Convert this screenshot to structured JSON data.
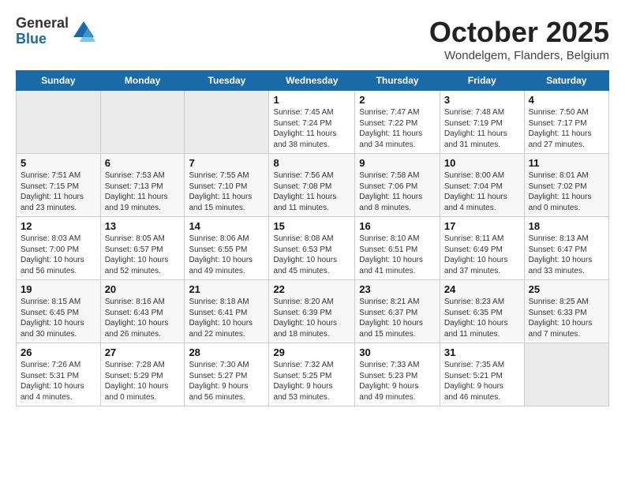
{
  "header": {
    "logo": {
      "general": "General",
      "blue": "Blue"
    },
    "title": "October 2025",
    "location": "Wondelgem, Flanders, Belgium"
  },
  "weekdays": [
    "Sunday",
    "Monday",
    "Tuesday",
    "Wednesday",
    "Thursday",
    "Friday",
    "Saturday"
  ],
  "weeks": [
    [
      {
        "num": "",
        "info": ""
      },
      {
        "num": "",
        "info": ""
      },
      {
        "num": "",
        "info": ""
      },
      {
        "num": "1",
        "info": "Sunrise: 7:45 AM\nSunset: 7:24 PM\nDaylight: 11 hours\nand 38 minutes."
      },
      {
        "num": "2",
        "info": "Sunrise: 7:47 AM\nSunset: 7:22 PM\nDaylight: 11 hours\nand 34 minutes."
      },
      {
        "num": "3",
        "info": "Sunrise: 7:48 AM\nSunset: 7:19 PM\nDaylight: 11 hours\nand 31 minutes."
      },
      {
        "num": "4",
        "info": "Sunrise: 7:50 AM\nSunset: 7:17 PM\nDaylight: 11 hours\nand 27 minutes."
      }
    ],
    [
      {
        "num": "5",
        "info": "Sunrise: 7:51 AM\nSunset: 7:15 PM\nDaylight: 11 hours\nand 23 minutes."
      },
      {
        "num": "6",
        "info": "Sunrise: 7:53 AM\nSunset: 7:13 PM\nDaylight: 11 hours\nand 19 minutes."
      },
      {
        "num": "7",
        "info": "Sunrise: 7:55 AM\nSunset: 7:10 PM\nDaylight: 11 hours\nand 15 minutes."
      },
      {
        "num": "8",
        "info": "Sunrise: 7:56 AM\nSunset: 7:08 PM\nDaylight: 11 hours\nand 11 minutes."
      },
      {
        "num": "9",
        "info": "Sunrise: 7:58 AM\nSunset: 7:06 PM\nDaylight: 11 hours\nand 8 minutes."
      },
      {
        "num": "10",
        "info": "Sunrise: 8:00 AM\nSunset: 7:04 PM\nDaylight: 11 hours\nand 4 minutes."
      },
      {
        "num": "11",
        "info": "Sunrise: 8:01 AM\nSunset: 7:02 PM\nDaylight: 11 hours\nand 0 minutes."
      }
    ],
    [
      {
        "num": "12",
        "info": "Sunrise: 8:03 AM\nSunset: 7:00 PM\nDaylight: 10 hours\nand 56 minutes."
      },
      {
        "num": "13",
        "info": "Sunrise: 8:05 AM\nSunset: 6:57 PM\nDaylight: 10 hours\nand 52 minutes."
      },
      {
        "num": "14",
        "info": "Sunrise: 8:06 AM\nSunset: 6:55 PM\nDaylight: 10 hours\nand 49 minutes."
      },
      {
        "num": "15",
        "info": "Sunrise: 8:08 AM\nSunset: 6:53 PM\nDaylight: 10 hours\nand 45 minutes."
      },
      {
        "num": "16",
        "info": "Sunrise: 8:10 AM\nSunset: 6:51 PM\nDaylight: 10 hours\nand 41 minutes."
      },
      {
        "num": "17",
        "info": "Sunrise: 8:11 AM\nSunset: 6:49 PM\nDaylight: 10 hours\nand 37 minutes."
      },
      {
        "num": "18",
        "info": "Sunrise: 8:13 AM\nSunset: 6:47 PM\nDaylight: 10 hours\nand 33 minutes."
      }
    ],
    [
      {
        "num": "19",
        "info": "Sunrise: 8:15 AM\nSunset: 6:45 PM\nDaylight: 10 hours\nand 30 minutes."
      },
      {
        "num": "20",
        "info": "Sunrise: 8:16 AM\nSunset: 6:43 PM\nDaylight: 10 hours\nand 26 minutes."
      },
      {
        "num": "21",
        "info": "Sunrise: 8:18 AM\nSunset: 6:41 PM\nDaylight: 10 hours\nand 22 minutes."
      },
      {
        "num": "22",
        "info": "Sunrise: 8:20 AM\nSunset: 6:39 PM\nDaylight: 10 hours\nand 18 minutes."
      },
      {
        "num": "23",
        "info": "Sunrise: 8:21 AM\nSunset: 6:37 PM\nDaylight: 10 hours\nand 15 minutes."
      },
      {
        "num": "24",
        "info": "Sunrise: 8:23 AM\nSunset: 6:35 PM\nDaylight: 10 hours\nand 11 minutes."
      },
      {
        "num": "25",
        "info": "Sunrise: 8:25 AM\nSunset: 6:33 PM\nDaylight: 10 hours\nand 7 minutes."
      }
    ],
    [
      {
        "num": "26",
        "info": "Sunrise: 7:26 AM\nSunset: 5:31 PM\nDaylight: 10 hours\nand 4 minutes."
      },
      {
        "num": "27",
        "info": "Sunrise: 7:28 AM\nSunset: 5:29 PM\nDaylight: 10 hours\nand 0 minutes."
      },
      {
        "num": "28",
        "info": "Sunrise: 7:30 AM\nSunset: 5:27 PM\nDaylight: 9 hours\nand 56 minutes."
      },
      {
        "num": "29",
        "info": "Sunrise: 7:32 AM\nSunset: 5:25 PM\nDaylight: 9 hours\nand 53 minutes."
      },
      {
        "num": "30",
        "info": "Sunrise: 7:33 AM\nSunset: 5:23 PM\nDaylight: 9 hours\nand 49 minutes."
      },
      {
        "num": "31",
        "info": "Sunrise: 7:35 AM\nSunset: 5:21 PM\nDaylight: 9 hours\nand 46 minutes."
      },
      {
        "num": "",
        "info": ""
      }
    ]
  ]
}
